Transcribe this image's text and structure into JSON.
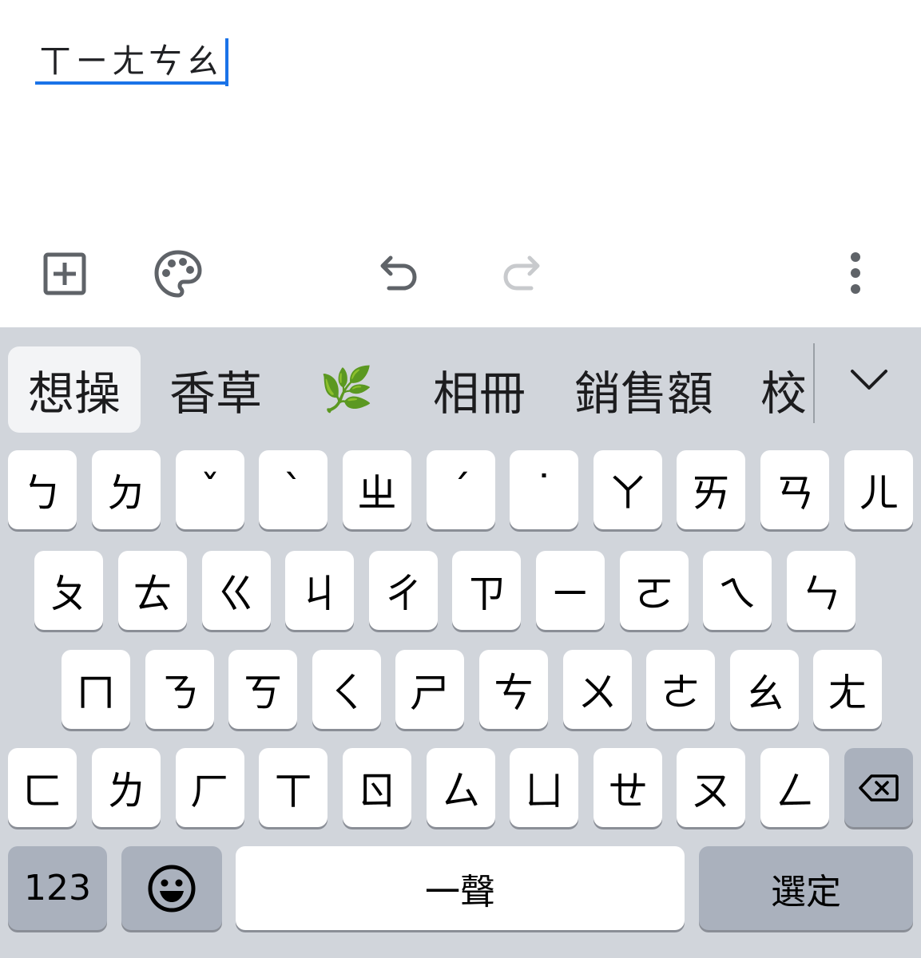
{
  "editor": {
    "composing_text": "ㄒㄧㄤㄘㄠ",
    "toolbar": {
      "add_icon": "add-box-icon",
      "palette_icon": "palette-icon",
      "undo_icon": "undo-icon",
      "redo_icon": "redo-icon",
      "more_icon": "more-vert-icon"
    }
  },
  "keyboard": {
    "candidates": [
      "想操",
      "香草",
      "🌿",
      "相冊",
      "銷售額",
      "校"
    ],
    "rows": [
      [
        "ㄅ",
        "ㄉ",
        "ˇ",
        "ˋ",
        "ㄓ",
        "ˊ",
        "˙",
        "ㄚ",
        "ㄞ",
        "ㄢ",
        "ㄦ"
      ],
      [
        "ㄆ",
        "ㄊ",
        "ㄍ",
        "ㄐ",
        "ㄔ",
        "ㄗ",
        "ㄧ",
        "ㄛ",
        "ㄟ",
        "ㄣ"
      ],
      [
        "ㄇ",
        "ㄋ",
        "ㄎ",
        "ㄑ",
        "ㄕ",
        "ㄘ",
        "ㄨ",
        "ㄜ",
        "ㄠ",
        "ㄤ"
      ],
      [
        "ㄈ",
        "ㄌ",
        "ㄏ",
        "ㄒ",
        "ㄖ",
        "ㄙ",
        "ㄩ",
        "ㄝ",
        "ㄡ",
        "ㄥ"
      ]
    ],
    "bottom": {
      "numbers_label": "123",
      "space_label": "一聲",
      "select_label": "選定"
    },
    "colors": {
      "accent": "#1a73e8",
      "keyboard_bg": "#d1d5db",
      "key_bg": "#ffffff",
      "func_key_bg": "#aab1bd"
    }
  }
}
